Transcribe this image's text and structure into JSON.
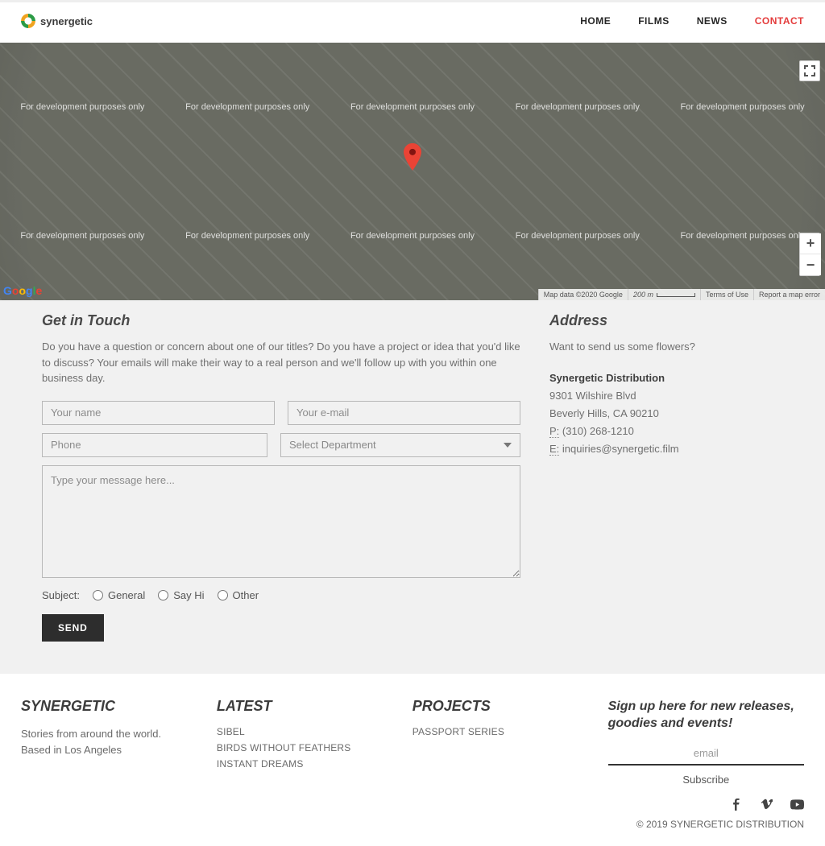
{
  "brand": {
    "name": "synergetic"
  },
  "nav": {
    "items": [
      {
        "label": "HOME",
        "active": false
      },
      {
        "label": "FILMS",
        "active": false
      },
      {
        "label": "NEWS",
        "active": false
      },
      {
        "label": "CONTACT",
        "active": true
      }
    ]
  },
  "map": {
    "dev_label": "For development purposes only",
    "attrib_data": "Map data ©2020 Google",
    "scale": "200 m",
    "terms": "Terms of Use",
    "report": "Report a map error",
    "fullscreen_title": "Toggle fullscreen"
  },
  "contact": {
    "title": "Get in Touch",
    "intro": "Do you have a question or concern about one of our titles? Do you have a project or idea that you'd like to discuss? Your emails will make their way to a real person and we'll follow up with you within one business day.",
    "placeholders": {
      "name": "Your name",
      "email": "Your e-mail",
      "phone": "Phone",
      "message": "Type your message here..."
    },
    "department_label": "Select Department",
    "subject_label": "Subject:",
    "subjects": [
      "General",
      "Say Hi",
      "Other"
    ],
    "send_label": "SEND"
  },
  "address": {
    "title": "Address",
    "lead": "Want to send us some flowers?",
    "company": "Synergetic Distribution",
    "street": "9301 Wilshire Blvd",
    "citystate": "Beverly Hills, CA 90210",
    "phone_abbr": "P:",
    "phone": "(310) 268-1210",
    "email_abbr": "E:",
    "email": "inquiries@synergetic.film"
  },
  "footer": {
    "col1_h": "SYNERGETIC",
    "col1_l1": "Stories from around the world.",
    "col1_l2": "Based in Los Angeles",
    "col2_h": "LATEST",
    "latest": [
      "SIBEL",
      "BIRDS WITHOUT FEATHERS",
      "INSTANT DREAMS"
    ],
    "col3_h": "PROJECTS",
    "projects": [
      "PASSPORT SERIES"
    ],
    "signup_h": "Sign up here for new releases, goodies and events!",
    "email_placeholder": "email",
    "subscribe": "Subscribe",
    "copyright": "© 2019 SYNERGETIC DISTRIBUTION"
  }
}
